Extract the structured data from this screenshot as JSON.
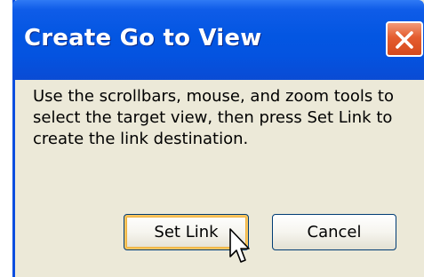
{
  "dialog": {
    "title": "Create Go to View",
    "message": "Use the scrollbars, mouse, and zoom tools to select the target view, then press Set Link to create the link destination.",
    "buttons": {
      "set_link": "Set Link",
      "cancel": "Cancel"
    },
    "close_icon": "close-x-icon",
    "cursor_icon": "arrow-pointer-icon"
  },
  "colors": {
    "titlebar": "#0356e2",
    "body": "#ece9d8",
    "close_button": "#e45c2f",
    "default_button_highlight": "#f7c55f"
  }
}
